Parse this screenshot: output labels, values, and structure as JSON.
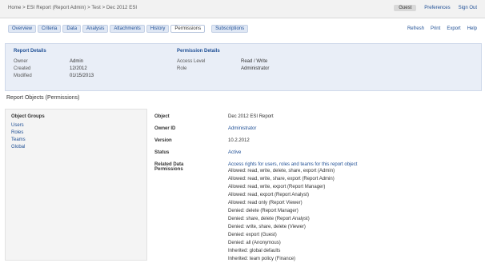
{
  "header": {
    "title": "Home > ESI Report (Report Admin) > Test > Dec 2012 ESI",
    "user_pill": "Guest",
    "links": [
      "Preferences",
      "Sign Out"
    ]
  },
  "tabs": [
    {
      "label": "Overview"
    },
    {
      "label": "Criteria"
    },
    {
      "label": "Data"
    },
    {
      "label": "Analysis"
    },
    {
      "label": "Attachments"
    },
    {
      "label": "History"
    },
    {
      "label": "Permissions",
      "active": true
    },
    {
      "label": "Subscriptions"
    }
  ],
  "tab_links": [
    "Refresh",
    "Print",
    "Export",
    "Help"
  ],
  "summary": {
    "left_title": "Report Details",
    "left_rows": [
      {
        "k": "Owner",
        "v": "Admin"
      },
      {
        "k": "Created",
        "v": "12/2012"
      },
      {
        "k": "Modified",
        "v": "01/15/2013"
      }
    ],
    "right_title": "Permission Details",
    "right_rows": [
      {
        "k": "Access Level",
        "v": "Read / Write"
      },
      {
        "k": "Role",
        "v": "Administrator"
      }
    ]
  },
  "section_title": "Report Objects (Permissions)",
  "leftnav": {
    "header": "Object Groups",
    "items": [
      "Users",
      "Roles",
      "Teams",
      "Global"
    ]
  },
  "detail": {
    "rows": [
      {
        "label": "Object",
        "value": "Dec 2012 ESI Report"
      },
      {
        "label": "Owner ID",
        "value": "Administrator",
        "link": true
      },
      {
        "label": "Version",
        "value": "10.2.2012"
      },
      {
        "label": "Status",
        "value": "Active",
        "link": true
      },
      {
        "label": "Related Data",
        "value": "Access rights for users, roles and teams for this report object",
        "link": true
      }
    ],
    "block_label": "Permissions",
    "lines": [
      "Allowed: read, write, delete, share, export (Admin)",
      "Allowed: read, write, share, export (Report Admin)",
      "Allowed: read, write, export (Report Manager)",
      "Allowed: read, export (Report Analyst)",
      "Allowed: read only (Report Viewer)",
      "Denied: delete (Report Manager)",
      "Denied: share, delete (Report Analyst)",
      "Denied: write, share, delete (Viewer)",
      "Denied: export (Guest)",
      "Denied: all (Anonymous)",
      "Inherited: global defaults",
      "Inherited: team policy (Finance)"
    ]
  }
}
